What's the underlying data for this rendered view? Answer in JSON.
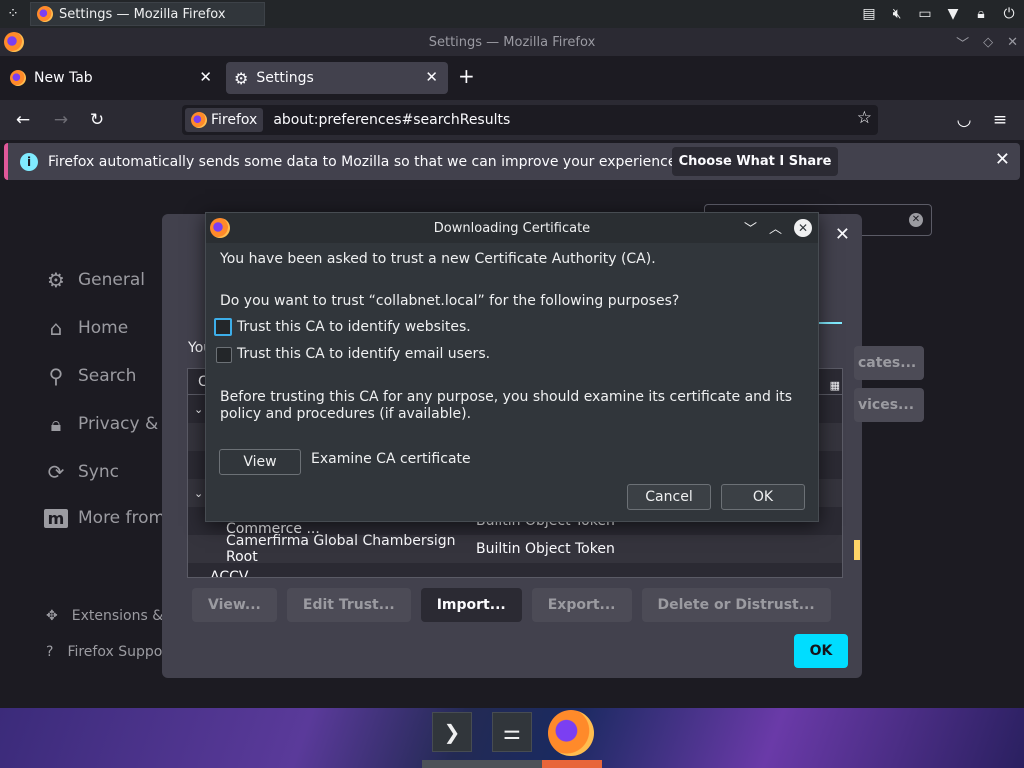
{
  "kde_panel": {
    "launcher_icon": "kde-launcher-icon",
    "task_label": "Settings — Mozilla Firefox",
    "tray_icons": [
      "clipboard-icon",
      "volume-muted-icon",
      "display-icon",
      "chevron-down-icon",
      "lock-icon",
      "power-icon"
    ]
  },
  "window": {
    "title": "Settings — Mozilla Firefox"
  },
  "tabs": [
    {
      "label": "New Tab",
      "icon": "firefox-icon"
    },
    {
      "label": "Settings",
      "icon": "gear-icon"
    }
  ],
  "navbar": {
    "identity_label": "Firefox",
    "url": "about:preferences#searchResults"
  },
  "notification": {
    "message": "Firefox automatically sends some data to Mozilla so that we can improve your experience.",
    "button": "Choose What I Share"
  },
  "sidebar": {
    "categories": [
      {
        "label": "General",
        "icon": "gear-icon"
      },
      {
        "label": "Home",
        "icon": "home-icon"
      },
      {
        "label": "Search",
        "icon": "search-icon"
      },
      {
        "label": "Privacy & S",
        "icon": "lock-icon"
      },
      {
        "label": "Sync",
        "icon": "sync-icon"
      },
      {
        "label": "More from",
        "icon": "mozilla-icon"
      }
    ],
    "footer": [
      {
        "label": "Extensions &",
        "icon": "puzzle-icon"
      },
      {
        "label": "Firefox Suppo",
        "icon": "help-icon"
      }
    ]
  },
  "cert_manager": {
    "intro_text": "You",
    "tree_header": "C",
    "rows": [
      {
        "name": "Camerfirma Chambers of Commerce ...",
        "token": "Builtin Object Token"
      },
      {
        "name": "Camerfirma Global Chambersign Root",
        "token": "Builtin Object Token"
      },
      {
        "name": "ACCV",
        "token": ""
      }
    ],
    "side_buttons": [
      "cates...",
      "vices..."
    ],
    "buttons": [
      "View...",
      "Edit Trust...",
      "Import...",
      "Export...",
      "Delete or Distrust..."
    ],
    "ok_label": "OK"
  },
  "download_dialog": {
    "title": "Downloading Certificate",
    "line1": "You have been asked to trust a new Certificate Authority (CA).",
    "line2": "Do you want to trust “collabnet.local” for the following purposes?",
    "checkbox_websites": "Trust this CA to identify websites.",
    "checkbox_email": "Trust this CA to identify email users.",
    "advice_line1": "Before trusting this CA for any purpose, you should examine its certificate and its",
    "advice_line2": "policy and procedures (if available).",
    "view_button": "View",
    "view_caption": "Examine CA certificate",
    "cancel_button": "Cancel",
    "ok_button": "OK"
  },
  "dock": {
    "items": [
      "terminal-icon",
      "settings-sliders-icon",
      "firefox-icon"
    ]
  }
}
